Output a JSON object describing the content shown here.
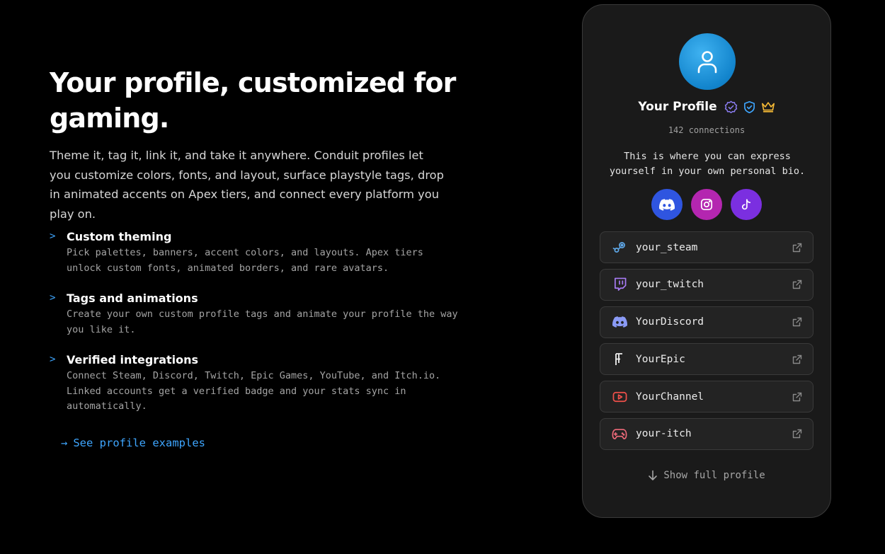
{
  "hero": {
    "headline": "Your profile, customized for gaming.",
    "intro": "Theme it, tag it, link it, and take it anywhere. Conduit profiles let you customize colors, fonts, and layout, surface playstyle tags, drop in animated accents on Apex tiers, and connect every platform you play on."
  },
  "features": [
    {
      "marker": ">",
      "title": "Custom theming",
      "desc": "Pick palettes, banners, accent colors, and layouts. Apex tiers unlock custom fonts, animated borders, and rare avatars."
    },
    {
      "marker": ">",
      "title": "Tags and animations",
      "desc": "Create your own custom profile tags and animate your profile the way you like it."
    },
    {
      "marker": ">",
      "title": "Verified integrations",
      "desc": "Connect Steam, Discord, Twitch, Epic Games, YouTube, and Itch.io. Linked accounts get a verified badge and your stats sync in automatically."
    }
  ],
  "cta": {
    "arrow": "→",
    "label": "See profile examples"
  },
  "profile": {
    "avatar_icon": "user-icon",
    "name": "Your Profile",
    "badges": [
      "verified-badge-icon",
      "shield-check-icon",
      "crown-icon"
    ],
    "connections": "142 connections",
    "bio": "This is where you can express yourself in your own personal bio.",
    "socials": [
      {
        "icon": "discord-icon",
        "color": "#2f55e0"
      },
      {
        "icon": "instagram-icon",
        "color": "#b426b0"
      },
      {
        "icon": "tiktok-icon",
        "color": "#7b2fe0"
      }
    ],
    "links": [
      {
        "label": "your_steam",
        "icon": "steam-icon",
        "color": "#5fa8e8"
      },
      {
        "label": "your_twitch",
        "icon": "twitch-icon",
        "color": "#a77bf3"
      },
      {
        "label": "YourDiscord",
        "icon": "discord-icon",
        "color": "#8a9af5"
      },
      {
        "label": "YourEpic",
        "icon": "epic-games-icon",
        "color": "#f0f0f0"
      },
      {
        "label": "YourChannel",
        "icon": "youtube-icon",
        "color": "#f0504a"
      },
      {
        "label": "your-itch",
        "icon": "gamepad-icon",
        "color": "#f06a7a"
      }
    ],
    "show_full": "Show full profile"
  },
  "colors": {
    "accent": "#3ea6ff",
    "background": "#000000",
    "card": "#1a1a1a"
  }
}
